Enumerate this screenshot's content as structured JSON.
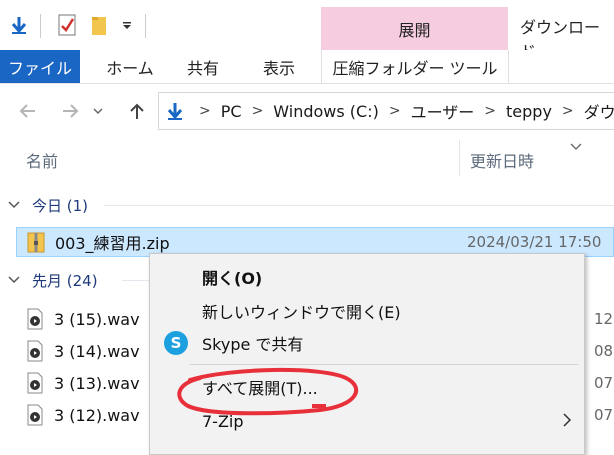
{
  "quick_access": {
    "save_icon": "down-arrow-icon",
    "properties_icon": "checklist-icon",
    "folder_icon": "folder-icon",
    "dropdown_icon": "chevron-down-icon"
  },
  "ribbon": {
    "context_tab_header": "展開",
    "window_title": "ダウンロード",
    "tabs": [
      "ファイル",
      "ホーム",
      "共有",
      "表示",
      "圧縮フォルダー ツール"
    ]
  },
  "address_bar": {
    "segments": [
      "PC",
      "Windows (C:)",
      "ユーザー",
      "teppy",
      "ダウンロ"
    ]
  },
  "columns": {
    "name": "名前",
    "modified": "更新日時"
  },
  "groups": {
    "today": {
      "label": "今日 (1)"
    },
    "last_month": {
      "label": "先月 (24)"
    }
  },
  "files": [
    {
      "name": "003_練習用.zip",
      "date": "2024/03/21 17:50",
      "type": "zip"
    },
    {
      "name": "3 (15).wav",
      "date": "12",
      "type": "wav"
    },
    {
      "name": "3 (14).wav",
      "date": "08",
      "type": "wav"
    },
    {
      "name": "3 (13).wav",
      "date": "07",
      "type": "wav"
    },
    {
      "name": "3 (12).wav",
      "date": "07",
      "type": "wav"
    }
  ],
  "context_menu": {
    "items": [
      {
        "label": "開く(O)"
      },
      {
        "label": "新しいウィンドウで開く(E)"
      },
      {
        "label": "Skype で共有",
        "icon": "skype-icon",
        "icon_text": "S"
      },
      {
        "label": "すべて展開(T)..."
      },
      {
        "label": "7-Zip"
      }
    ],
    "annotation_color": "#e8303a"
  },
  "colors": {
    "file_tab": "#1a66c5",
    "context_header": "#f6cde0",
    "selection": "#cce8ff",
    "menu_bg": "#f2f2f2"
  }
}
